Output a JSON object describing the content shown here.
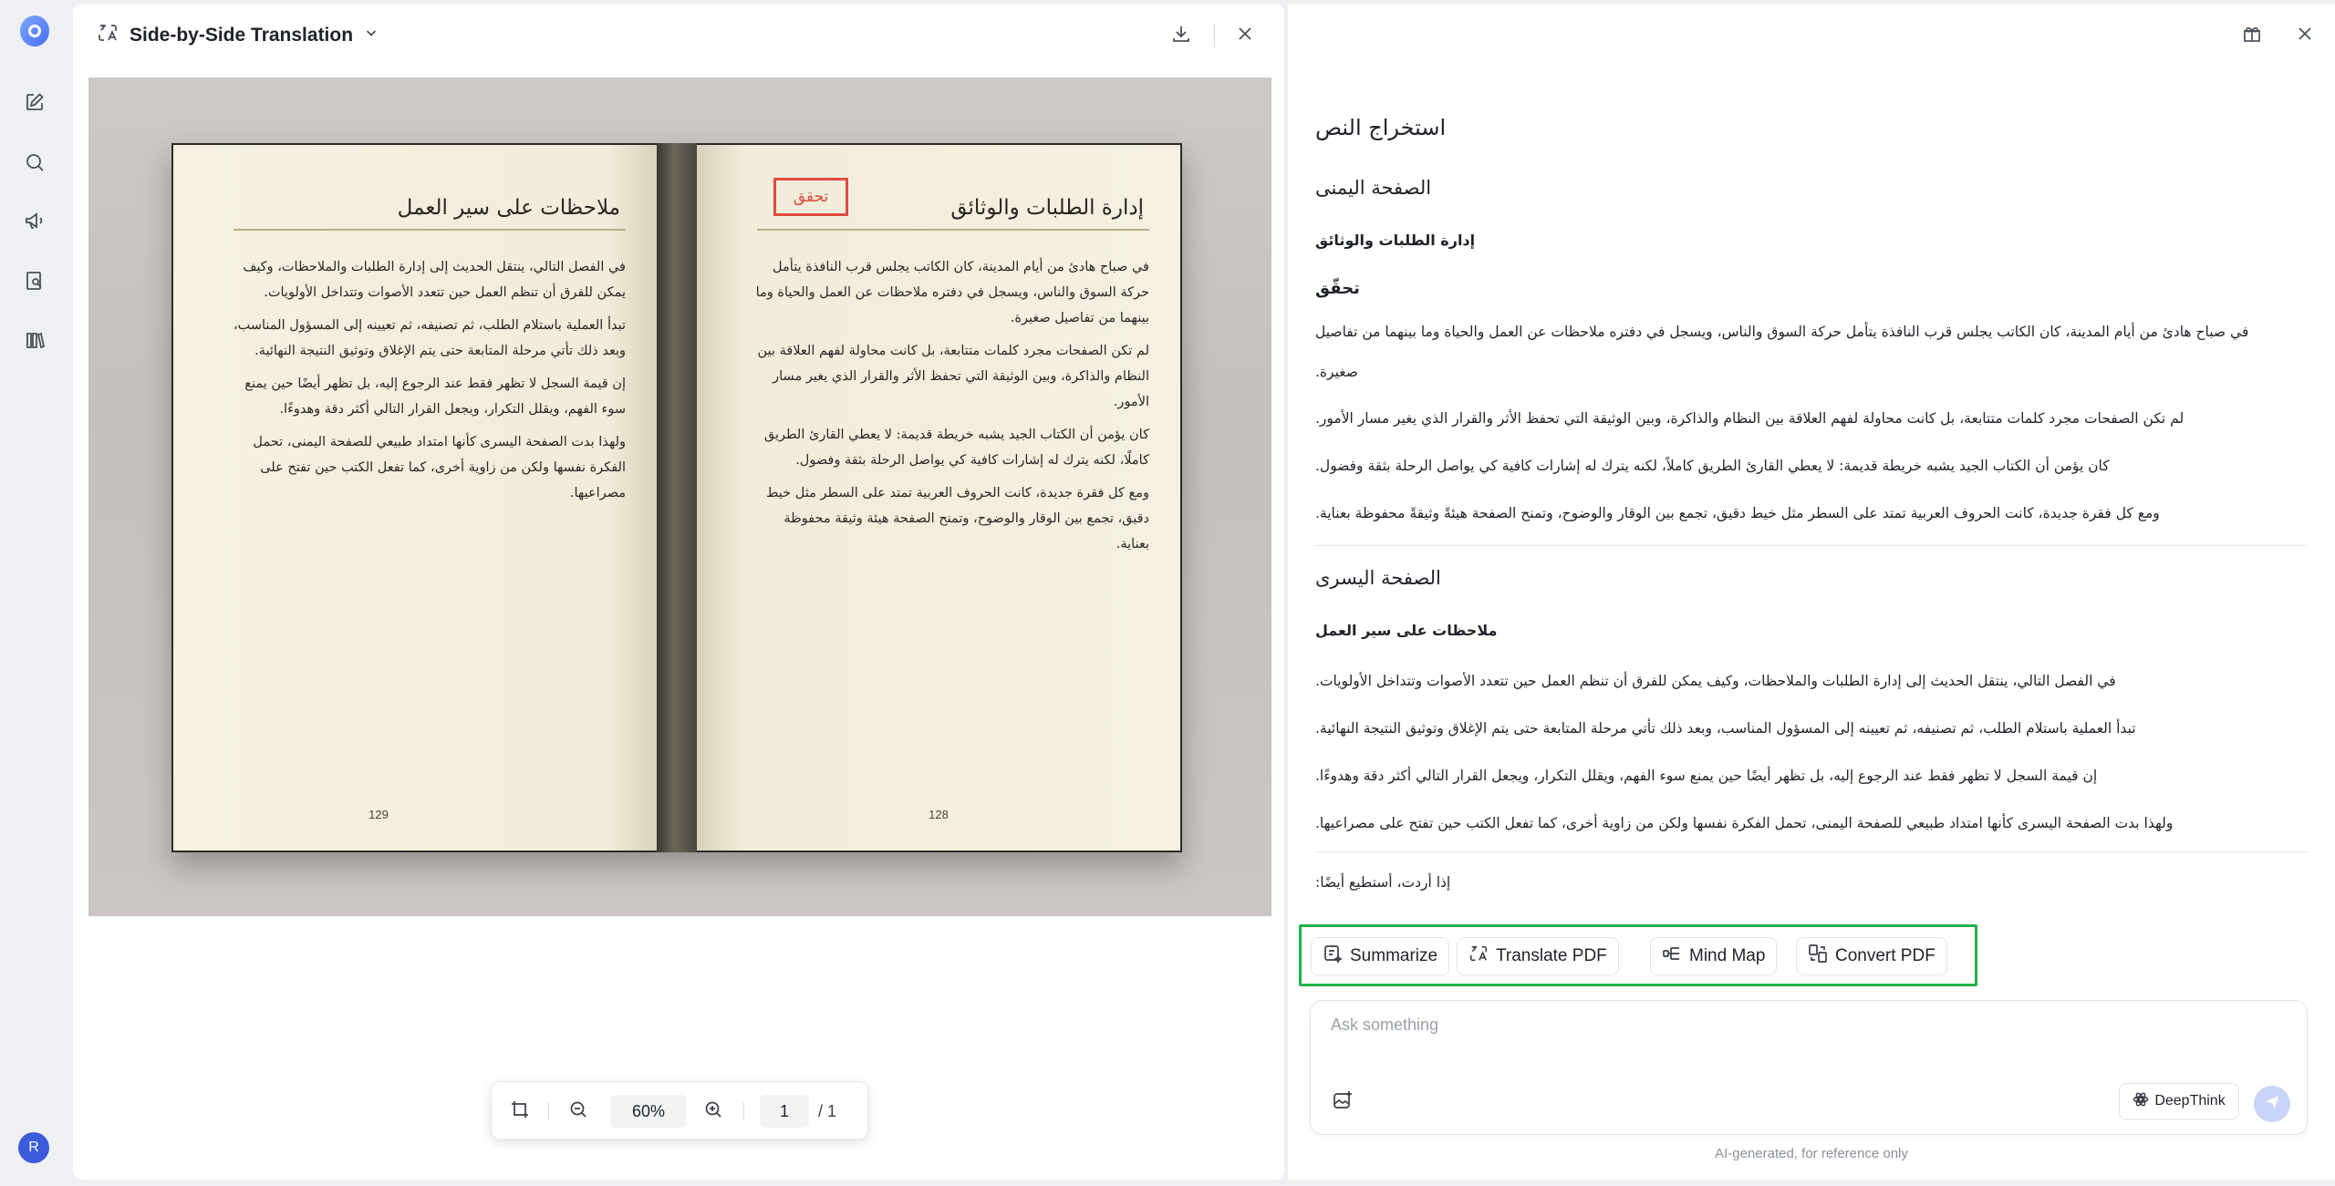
{
  "rail": {
    "items": [
      "new-chat-icon",
      "search-icon",
      "megaphone-icon",
      "doc-search-icon",
      "library-icon"
    ],
    "avatar_initial": "R"
  },
  "doc": {
    "title": "Side-by-Side Translation",
    "left_page": {
      "heading": "ملاحظات على سير العمل",
      "paragraphs": [
        "في الفصل التالي، ينتقل الحديث إلى إدارة الطلبات والملاحظات، وكيف يمكن للفرق أن تنظم العمل حين تتعدد الأصوات وتتداخل الأولويات.",
        "تبدأ العملية باستلام الطلب، ثم تصنيفه، ثم تعيينه إلى المسؤول المناسب، وبعد ذلك تأتي مرحلة المتابعة حتى يتم الإغلاق وتوثيق النتيجة النهائية.",
        "إن قيمة السجل لا تظهر فقط عند الرجوع إليه، بل تظهر أيضًا حين يمنع سوء الفهم، ويقلل التكرار، ويجعل القرار التالي أكثر دقة وهدوءًا.",
        "ولهذا بدت الصفحة اليسرى كأنها امتداد طبيعي للصفحة اليمنى، تحمل الفكرة نفسها ولكن من زاوية أخرى، كما تفعل الكتب حين تفتح على مصراعيها."
      ],
      "page_number": "129"
    },
    "right_page": {
      "heading": "إدارة الطلبات والوثائق",
      "stamp": "تحقق",
      "paragraphs": [
        "في صباح هادئ من أيام المدينة، كان الكاتب يجلس قرب النافذة يتأمل حركة السوق والناس، ويسجل في دفتره ملاحظات عن العمل والحياة وما بينهما من تفاصيل صغيرة.",
        "لم تكن الصفحات مجرد كلمات متتابعة، بل كانت محاولة لفهم العلاقة بين النظام والذاكرة، وبين الوثيقة التي تحفظ الأثر والقرار الذي يغير مسار الأمور.",
        "كان يؤمن أن الكتاب الجيد يشبه خريطة قديمة: لا يعطي القارئ الطريق كاملًا، لكنه يترك له إشارات كافية كي يواصل الرحلة بثقة وفضول.",
        "ومع كل فقرة جديدة، كانت الحروف العربية تمتد على السطر مثل خيط دقيق، تجمع بين الوقار والوضوح، وتمنح الصفحة هيئة وثيقة محفوظة بعناية."
      ],
      "page_number": "128"
    },
    "toolbar": {
      "zoom": "60%",
      "current_page": "1",
      "total_pages": "/ 1"
    }
  },
  "chat": {
    "heading": "استخراج النص",
    "right_section": {
      "title": "الصفحة اليمنى",
      "subtitle": "إدارة الطلبات والوثائق",
      "stamp": "تحقّق",
      "p1": "في صباح هادئ من أيام المدينة، كان الكاتب يجلس قرب النافذة يتأمل حركة السوق والناس، ويسجل في دفتره ملاحظات عن العمل والحياة وما بينهما من تفاصيل",
      "p1b": "صغيرة.",
      "p2": "لم تكن الصفحات مجرد كلمات متتابعة، بل كانت محاولة لفهم العلاقة بين النظام والذاكرة، وبين الوثيقة التي تحفظ الأثر والقرار الذي يغير مسار الأمور.",
      "p3": "كان يؤمن أن الكتاب الجيد يشبه خريطة قديمة: لا يعطي القارئ الطريق كاملاً، لكنه يترك له إشارات كافية كي يواصل الرحلة بثقة وفضول.",
      "p4": "ومع كل فقرة جديدة، كانت الحروف العربية تمتد على السطر مثل خيط دقيق، تجمع بين الوقار والوضوح، وتمنح الصفحة هيئةً وثيقةً محفوظة بعناية."
    },
    "left_section": {
      "title": "الصفحة اليسرى",
      "subtitle": "ملاحظات على سير العمل",
      "p1": "في الفصل التالي، ينتقل الحديث إلى إدارة الطلبات والملاحظات، وكيف يمكن للفرق أن تنظم العمل حين تتعدد الأصوات وتتداخل الأولويات.",
      "p2": "تبدأ العملية باستلام الطلب، ثم تصنيفه، ثم تعيينه إلى المسؤول المناسب، وبعد ذلك تأتي مرحلة المتابعة حتى يتم الإغلاق وتوثيق النتيجة النهائية.",
      "p3": "إن قيمة السجل لا تظهر فقط عند الرجوع إليه، بل تظهر أيضًا حين يمنع سوء الفهم، ويقلل التكرار، ويجعل القرار التالي أكثر دقة وهدوءًا.",
      "p4": "ولهذا بدت الصفحة اليسرى كأنها امتداد طبيعي للصفحة اليمنى، تحمل الفكرة نفسها ولكن من زاوية أخرى، كما تفعل الكتب حين تفتح على مصراعيها."
    },
    "closing": "إذا أردت، أستطيع أيضًا:",
    "actions": {
      "summarize": "Summarize",
      "translate": "Translate PDF",
      "mindmap": "Mind Map",
      "convert": "Convert PDF"
    },
    "input": {
      "placeholder": "Ask something",
      "value": ""
    },
    "deepthink": "DeepThink",
    "footnote": "AI-generated, for reference only",
    "accent": "#21b24a",
    "stamp_color": "#e04b3c"
  }
}
